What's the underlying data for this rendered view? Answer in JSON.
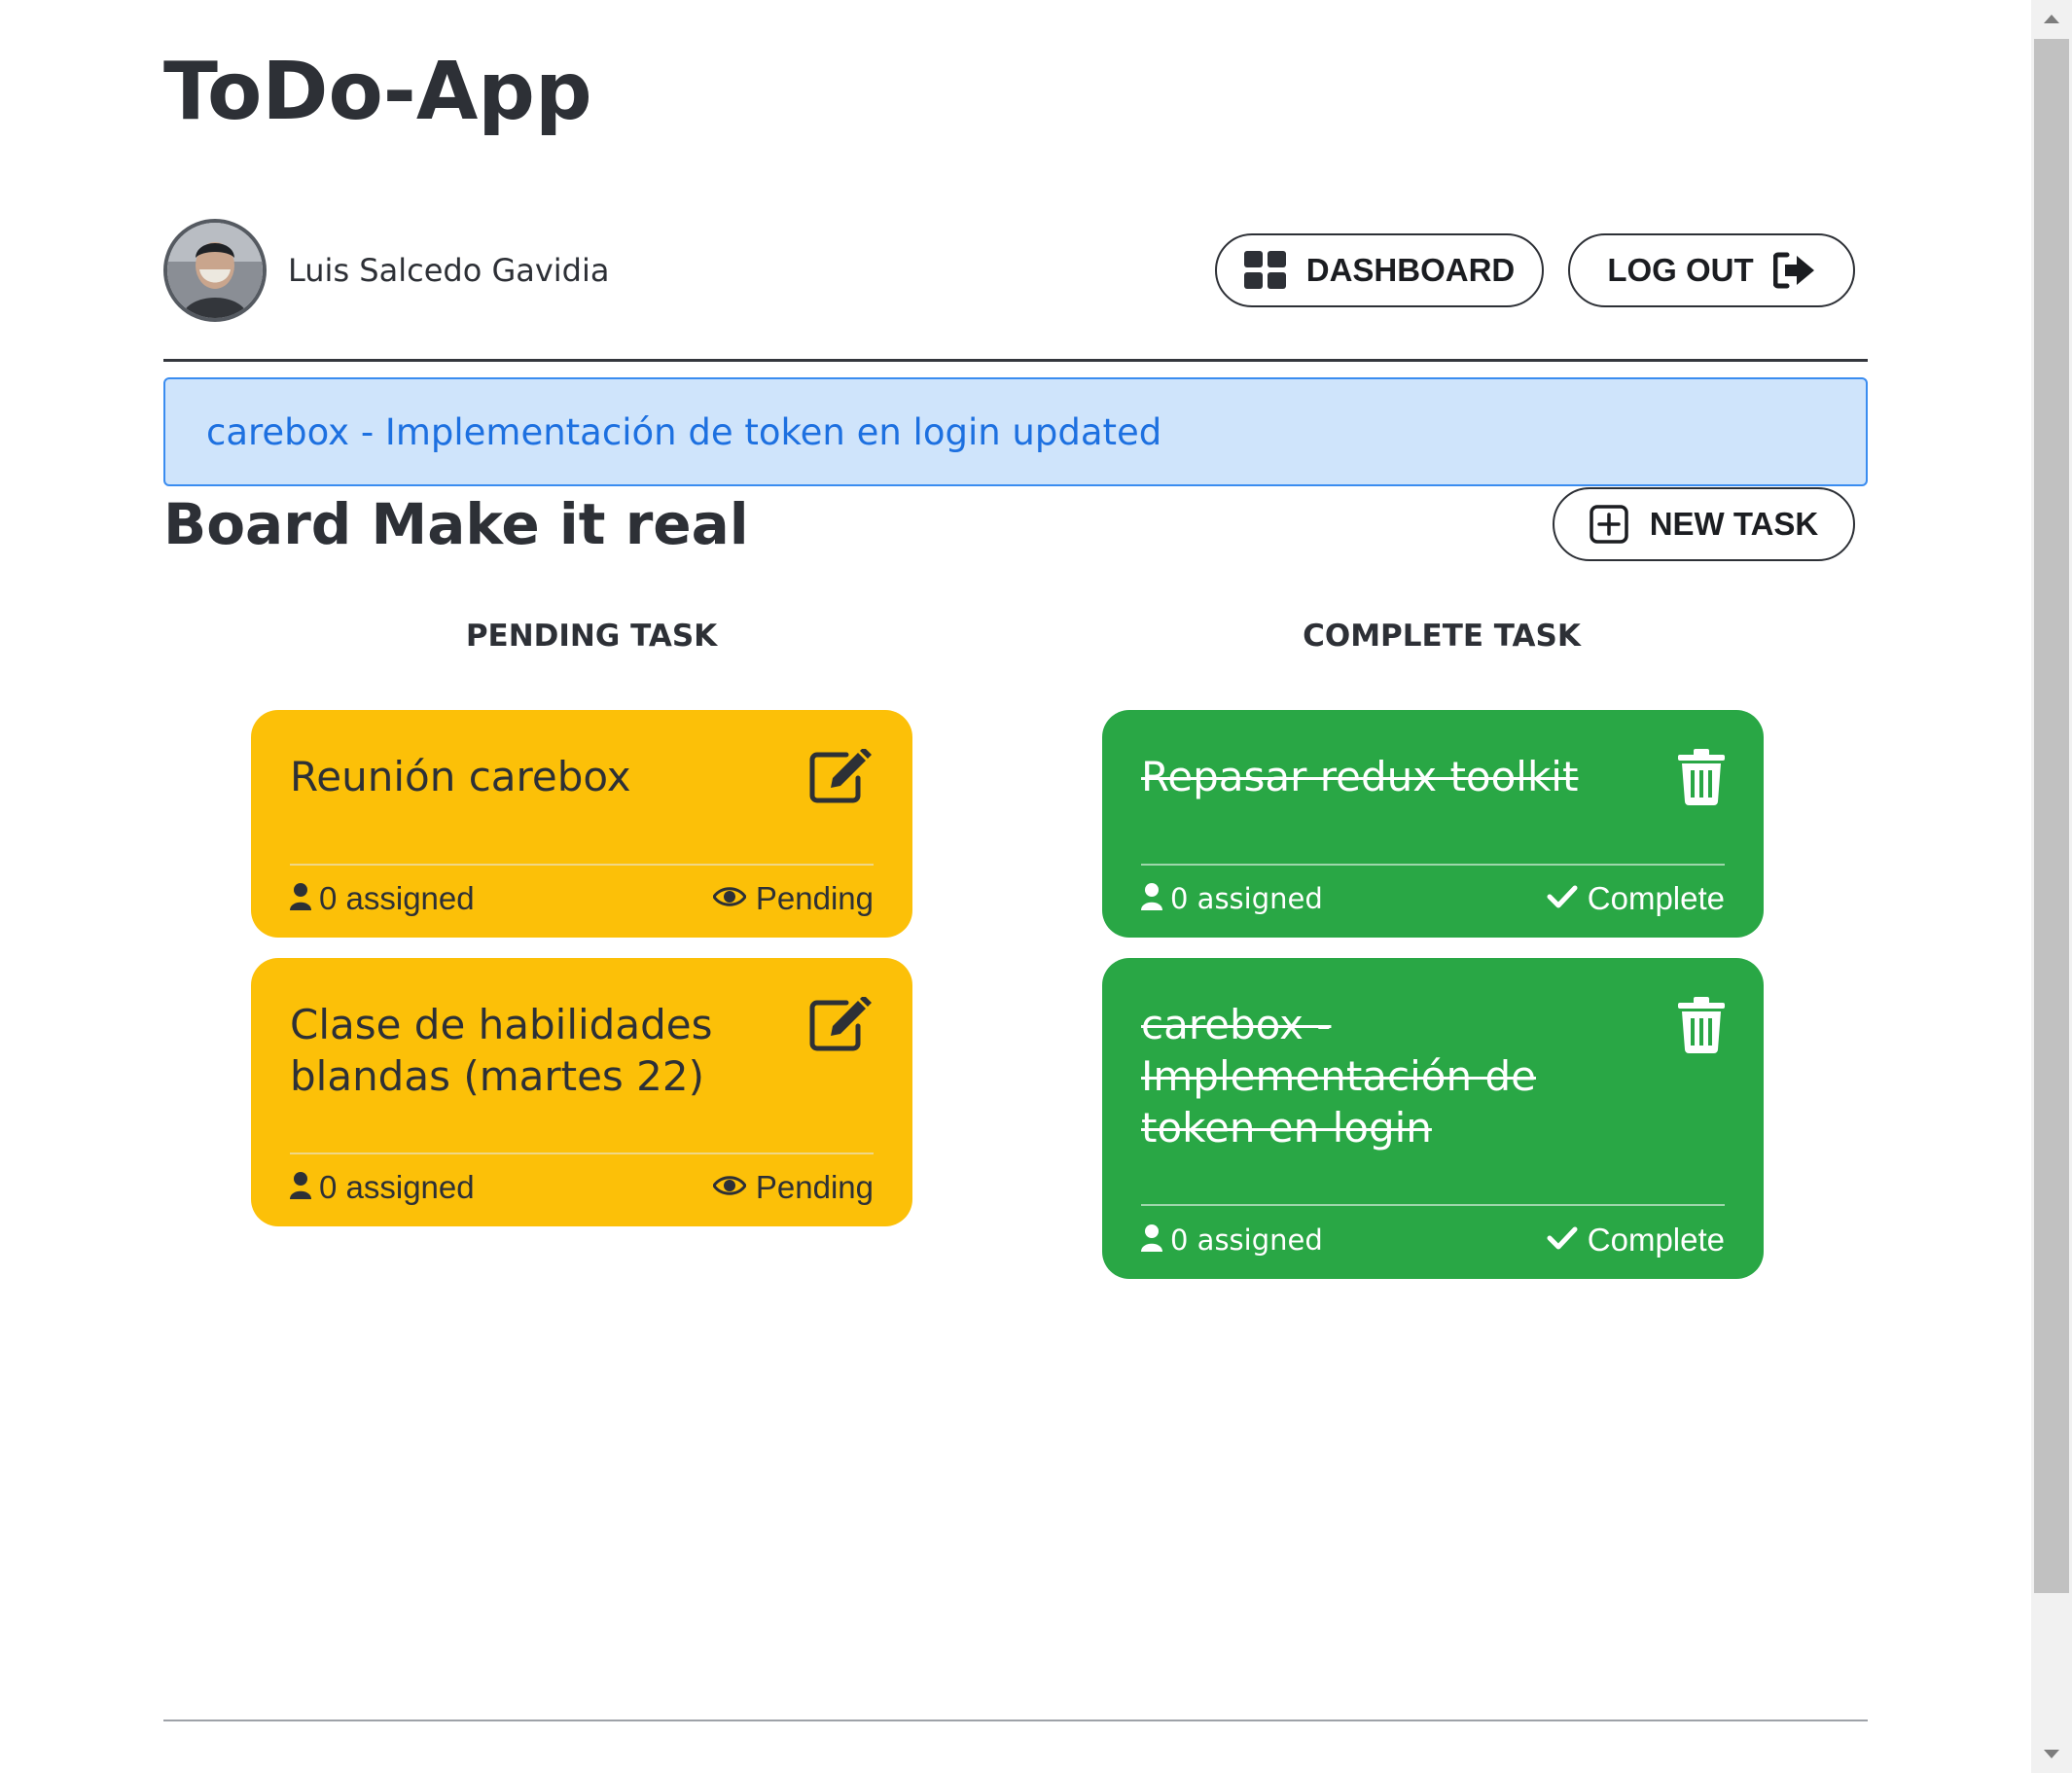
{
  "app": {
    "title": "ToDo-App"
  },
  "user": {
    "name": "Luis Salcedo Gavidia"
  },
  "nav": {
    "dashboard_label": "DASHBOARD",
    "logout_label": "LOG OUT"
  },
  "alert": {
    "message": "carebox - Implementación de token en login updated"
  },
  "board": {
    "title": "Board Make it real",
    "new_task_label": "NEW TASK"
  },
  "columns": {
    "pending_title": "PENDING TASK",
    "complete_title": "COMPLETE TASK"
  },
  "pending_tasks": [
    {
      "title": "Reunión carebox",
      "assigned": "0 assigned",
      "status": "Pending"
    },
    {
      "title": "Clase de habilidades blandas (martes 22)",
      "assigned": "0 assigned",
      "status": "Pending"
    }
  ],
  "complete_tasks": [
    {
      "title": "Repasar redux toolkit",
      "assigned": "0 assigned",
      "status": "Complete"
    },
    {
      "title": "carebox - Implementación de token en login",
      "assigned": "0 assigned",
      "status": "Complete"
    }
  ],
  "colors": {
    "pending_card": "#fcc008",
    "complete_card": "#29a745",
    "alert_bg": "#cfe4fb",
    "alert_text": "#1d70e0"
  },
  "icons": {
    "dashboard": "grid-icon",
    "logout": "sign-out-icon",
    "new_task": "plus-square-icon",
    "edit": "edit-icon",
    "delete": "trash-icon",
    "user": "user-icon",
    "pending": "eye-icon",
    "complete": "check-icon"
  }
}
